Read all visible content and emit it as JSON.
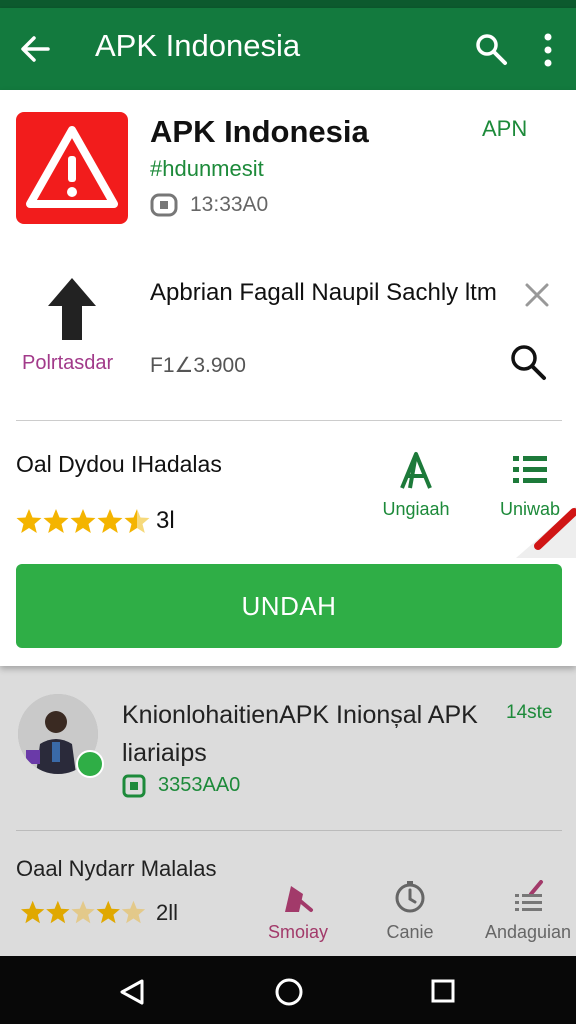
{
  "app_bar": {
    "title": "APK Indonesia",
    "back_icon": "arrow-left-icon",
    "search_icon": "search-icon",
    "more_icon": "more-vert-icon"
  },
  "app": {
    "name": "APK Indonesia",
    "tag": "#hdunmesit",
    "meta": "13:33A0",
    "right_tag": "APN",
    "icon": "warning-triangle-icon"
  },
  "promo": {
    "label": "Polrtasdar",
    "title": "Apbrian Fagall Naupil Sachly ltm",
    "price": "F1∠3.900",
    "arrow_icon": "up-arrow-icon",
    "close_icon": "close-icon",
    "search_icon": "magnifier-icon"
  },
  "rating": {
    "title": "Oal Dydou IHadalas",
    "count": "3l",
    "stars": 4.5
  },
  "actions": [
    {
      "label": "Ungiaah",
      "icon": "font-a-icon"
    },
    {
      "label": "Uniwab",
      "icon": "list-icon"
    }
  ],
  "install_label": "UNDAH",
  "item2": {
    "title": "KnionlohaitienAPK Inionșal APK liariaips",
    "meta": "3353AA0",
    "tag": "14ste",
    "rating_title": "Oaal Nydarr Malalas",
    "rating_count": "2ll",
    "stars": 3.5
  },
  "bottom_tabs": [
    {
      "label": "Smoiay",
      "icon": "home-icon",
      "color": "#a23a6a"
    },
    {
      "label": "Canie",
      "icon": "clock-icon",
      "color": "#666666"
    },
    {
      "label": "Andaguian",
      "icon": "edit-list-icon",
      "color": "#666666"
    }
  ],
  "colors": {
    "primary": "#137a3e",
    "accent_green": "#2fae46",
    "star": "#f4b400",
    "icon_red": "#f21c1c"
  }
}
